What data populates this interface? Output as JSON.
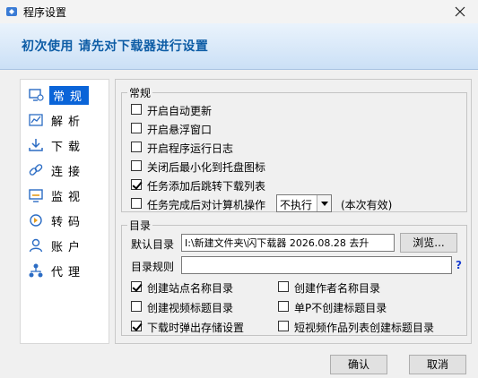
{
  "window": {
    "title": "程序设置",
    "close_glyph": "✕"
  },
  "header": {
    "title": "初次使用 请先对下载器进行设置"
  },
  "sidebar": {
    "items": [
      {
        "label": "常规",
        "icon": "monitor-gear-icon",
        "active": true
      },
      {
        "label": "解析",
        "icon": "chart-icon"
      },
      {
        "label": "下载",
        "icon": "download-icon"
      },
      {
        "label": "连接",
        "icon": "link-icon"
      },
      {
        "label": "监视",
        "icon": "monitor-icon"
      },
      {
        "label": "转码",
        "icon": "convert-icon"
      },
      {
        "label": "账户",
        "icon": "user-icon"
      },
      {
        "label": "代理",
        "icon": "network-icon"
      }
    ]
  },
  "general": {
    "title": "常规",
    "auto_update": {
      "label": "开启自动更新",
      "checked": false
    },
    "float_window": {
      "label": "开启悬浮窗口",
      "checked": false
    },
    "run_log": {
      "label": "开启程序运行日志",
      "checked": false
    },
    "minimize_tray": {
      "label": "关闭后最小化到托盘图标",
      "checked": false
    },
    "jump_list": {
      "label": "任务添加后跳转下载列表",
      "checked": true
    },
    "after_complete": {
      "label": "任务完成后对计算机操作",
      "checked": false
    },
    "action_select": {
      "value": "不执行"
    },
    "this_time": "(本次有效)"
  },
  "directory": {
    "title": "目录",
    "default_label": "默认目录",
    "default_value": "I:\\新建文件夹\\闪下载器 2026.08.28 去升",
    "browse_label": "浏览...",
    "rule_label": "目录规则",
    "rule_value": "",
    "help": "?",
    "opt_site": {
      "label": "创建站点名称目录",
      "checked": true
    },
    "opt_author": {
      "label": "创建作者名称目录",
      "checked": false
    },
    "opt_video_title": {
      "label": "创建视频标题目录",
      "checked": false
    },
    "opt_single_p": {
      "label": "单P不创建标题目录",
      "checked": false
    },
    "opt_popup": {
      "label": "下载时弹出存储设置",
      "checked": true
    },
    "opt_short_video": {
      "label": "短视频作品列表创建标题目录",
      "checked": false
    }
  },
  "footer": {
    "ok": "确认",
    "cancel": "取消"
  },
  "colors": {
    "accent": "#0a64d8",
    "header_text": "#0e5da6",
    "help": "#1a3fd1"
  }
}
